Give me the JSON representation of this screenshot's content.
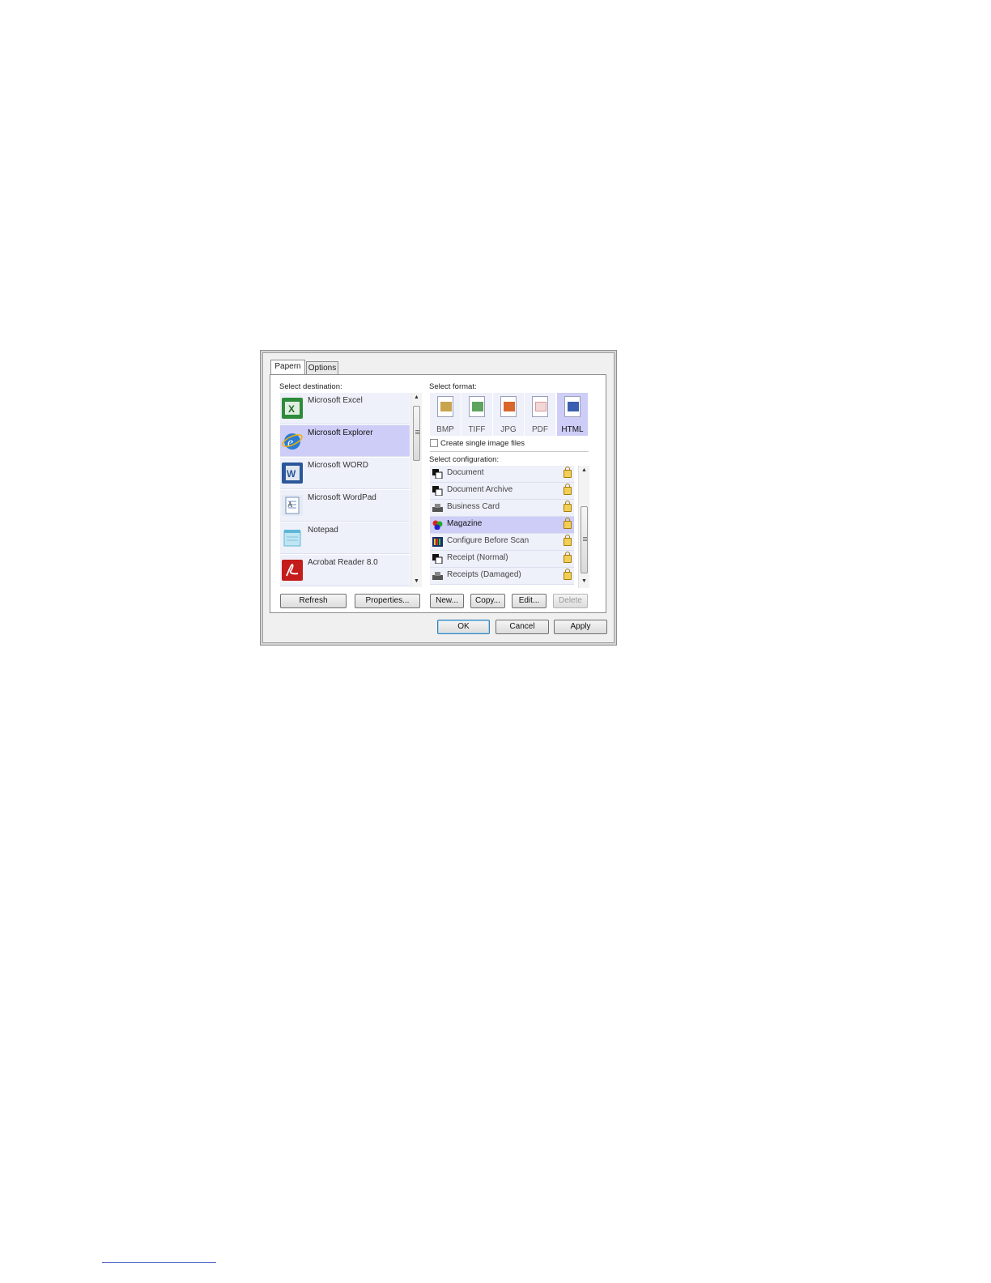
{
  "tabs": [
    {
      "label": "Papern",
      "active": true
    },
    {
      "label": "Options",
      "active": false
    }
  ],
  "destination": {
    "label": "Select destination:",
    "items": [
      {
        "label": "Microsoft Excel",
        "icon": "excel-icon",
        "color": "#2e8b3a",
        "selected": false
      },
      {
        "label": "Microsoft Explorer",
        "icon": "internet-explorer-icon",
        "color": "#2a7bd4",
        "selected": true
      },
      {
        "label": "Microsoft WORD",
        "icon": "word-icon",
        "color": "#2b579a",
        "selected": false
      },
      {
        "label": "Microsoft WordPad",
        "icon": "wordpad-icon",
        "color": "#6f8fbf",
        "selected": false
      },
      {
        "label": "Notepad",
        "icon": "notepad-icon",
        "color": "#5fb7d8",
        "selected": false
      },
      {
        "label": "Acrobat Reader 8.0",
        "icon": "acrobat-icon",
        "color": "#c41b1b",
        "selected": false
      }
    ]
  },
  "buttons": {
    "refresh": "Refresh",
    "properties": "Properties...",
    "new": "New...",
    "copy": "Copy...",
    "edit": "Edit...",
    "delete": "Delete",
    "ok": "OK",
    "cancel": "Cancel",
    "apply": "Apply"
  },
  "format": {
    "label": "Select format:",
    "items": [
      {
        "label": "BMP",
        "icon": "bmp-icon",
        "color": "#c9a44c",
        "selected": false
      },
      {
        "label": "TIFF",
        "icon": "tiff-icon",
        "color": "#5ea35e",
        "selected": false
      },
      {
        "label": "JPG",
        "icon": "jpg-icon",
        "color": "#d9662b",
        "selected": false
      },
      {
        "label": "PDF",
        "icon": "pdf-icon",
        "color": "#d99a9a",
        "selected": false
      },
      {
        "label": "HTML",
        "icon": "html-icon",
        "color": "#3a5fb0",
        "selected": true
      }
    ],
    "single_image_label": "Create single image files",
    "single_image_checked": false
  },
  "configuration": {
    "label": "Select configuration:",
    "items": [
      {
        "label": "Document",
        "icon": "document-icon",
        "selected": false
      },
      {
        "label": "Document Archive",
        "icon": "document-icon",
        "selected": false
      },
      {
        "label": "Business Card",
        "icon": "scanner-icon",
        "selected": false
      },
      {
        "label": "Magazine",
        "icon": "color-document-icon",
        "selected": true
      },
      {
        "label": "Configure Before Scan",
        "icon": "configure-icon",
        "selected": false
      },
      {
        "label": "Receipt (Normal)",
        "icon": "document-icon",
        "selected": false
      },
      {
        "label": "Receipts (Damaged)",
        "icon": "scanner-icon",
        "selected": false
      }
    ]
  },
  "colors": {
    "selection": "#cdcdf7",
    "row": "#eef0fa",
    "lock": "#f2cf54"
  }
}
